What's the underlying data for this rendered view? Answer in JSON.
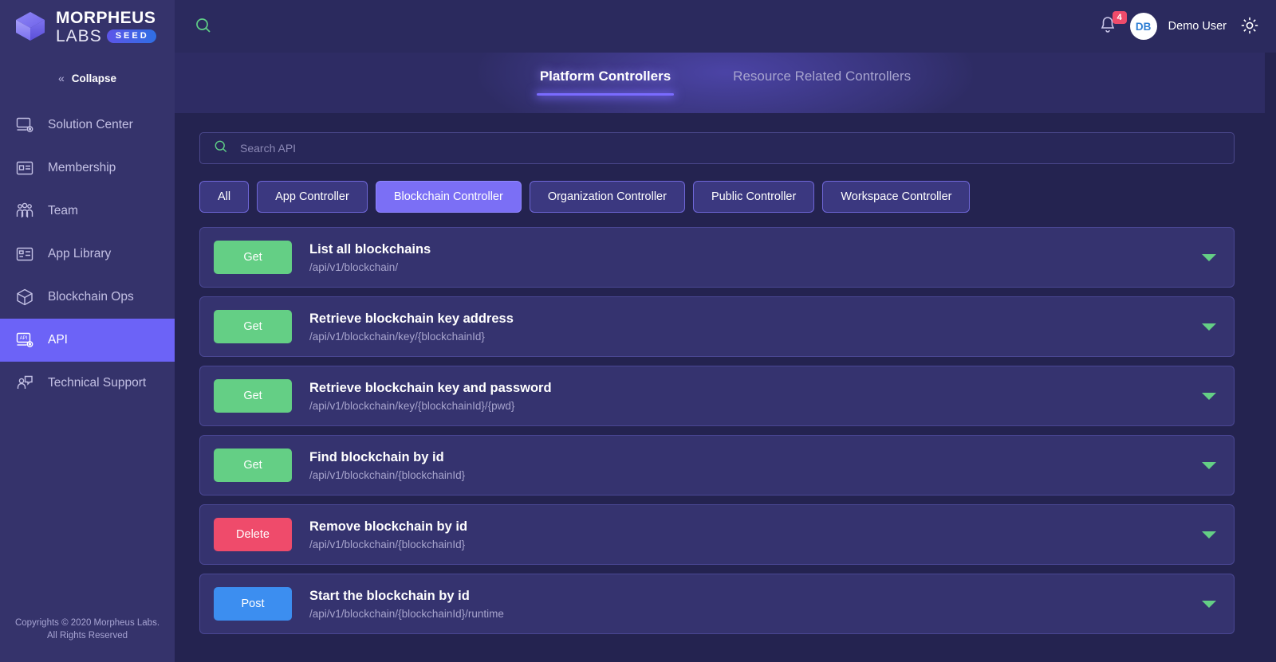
{
  "brand": {
    "name_line1": "MORPHEUS",
    "name_line2": "LABS",
    "badge": "SEED",
    "logo_icon": "cube-icon"
  },
  "sidebar": {
    "collapse": {
      "label": "Collapse",
      "icon": "double-chevron-left-icon"
    },
    "items": [
      {
        "label": "Solution Center",
        "icon": "monitor-gear-icon",
        "active": false
      },
      {
        "label": "Membership",
        "icon": "id-card-icon",
        "active": false
      },
      {
        "label": "Team",
        "icon": "people-icon",
        "active": false
      },
      {
        "label": "App Library",
        "icon": "library-card-icon",
        "active": false
      },
      {
        "label": "Blockchain Ops",
        "icon": "cube-outline-icon",
        "active": false
      },
      {
        "label": "API",
        "icon": "api-monitor-icon",
        "active": true
      },
      {
        "label": "Technical Support",
        "icon": "support-chat-icon",
        "active": false
      }
    ],
    "footer_line1": "Copyrights © 2020 Morpheus Labs.",
    "footer_line2": "All Rights Reserved"
  },
  "topbar": {
    "search_icon": "search-icon",
    "notifications": {
      "icon": "bell-icon",
      "count": "4"
    },
    "avatar_initials": "DB",
    "user_name": "Demo User",
    "settings_icon": "gear-icon"
  },
  "tabs": [
    {
      "label": "Platform Controllers",
      "active": true
    },
    {
      "label": "Resource Related Controllers",
      "active": false
    }
  ],
  "search": {
    "icon": "search-icon",
    "placeholder": "Search API",
    "value": ""
  },
  "filters": [
    {
      "label": "All",
      "active": false
    },
    {
      "label": "App Controller",
      "active": false
    },
    {
      "label": "Blockchain Controller",
      "active": true
    },
    {
      "label": "Organization Controller",
      "active": false
    },
    {
      "label": "Public Controller",
      "active": false
    },
    {
      "label": "Workspace Controller",
      "active": false
    }
  ],
  "endpoints": [
    {
      "method": "Get",
      "method_class": "m-get",
      "title": "List all blockchains",
      "path": "/api/v1/blockchain/",
      "chevron": "chevron-down-icon"
    },
    {
      "method": "Get",
      "method_class": "m-get",
      "title": "Retrieve blockchain key address",
      "path": "/api/v1/blockchain/key/{blockchainId}",
      "chevron": "chevron-down-icon"
    },
    {
      "method": "Get",
      "method_class": "m-get",
      "title": "Retrieve blockchain key and password",
      "path": "/api/v1/blockchain/key/{blockchainId}/{pwd}",
      "chevron": "chevron-down-icon"
    },
    {
      "method": "Get",
      "method_class": "m-get",
      "title": "Find blockchain by id",
      "path": "/api/v1/blockchain/{blockchainId}",
      "chevron": "chevron-down-icon"
    },
    {
      "method": "Delete",
      "method_class": "m-delete",
      "title": "Remove blockchain by id",
      "path": "/api/v1/blockchain/{blockchainId}",
      "chevron": "chevron-down-icon"
    },
    {
      "method": "Post",
      "method_class": "m-post",
      "title": "Start the blockchain by id",
      "path": "/api/v1/blockchain/{blockchainId}/runtime",
      "chevron": "chevron-down-icon"
    }
  ],
  "colors": {
    "sidebar_bg": "#35336b",
    "main_bg": "#242350",
    "topbar_bg": "#2b2a5e",
    "accent_purple": "#6c63f7",
    "tab_underline": "#7a6bff",
    "get_green": "#64cf85",
    "delete_red": "#ef4b6b",
    "post_blue": "#3c8ef0",
    "badge_red": "#ef4b6b"
  }
}
